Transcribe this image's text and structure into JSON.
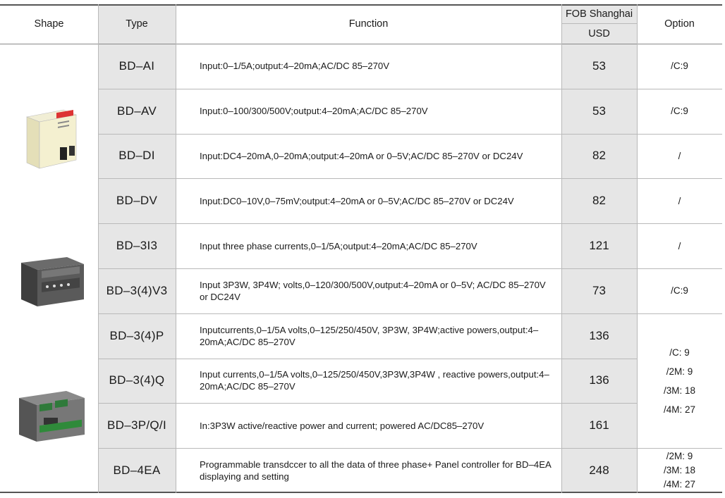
{
  "header": {
    "shape": "Shape",
    "type": "Type",
    "function": "Function",
    "fob": "FOB Shanghai",
    "currency": "USD",
    "option": "Option"
  },
  "rows": [
    {
      "type": "BD–AI",
      "function": "Input:0–1/5A;output:4–20mA;AC/DC 85–270V",
      "price": "53",
      "option": "/C:9"
    },
    {
      "type": "BD–AV",
      "function": "Input:0–100/300/500V;output:4–20mA;AC/DC 85–270V",
      "price": "53",
      "option": "/C:9"
    },
    {
      "type": "BD–DI",
      "function": "Input:DC4–20mA,0–20mA;output:4–20mA or 0–5V;AC/DC 85–270V or DC24V",
      "price": "82",
      "option": "/"
    },
    {
      "type": "BD–DV",
      "function": "Input:DC0–10V,0–75mV;output:4–20mA or 0–5V;AC/DC 85–270V or DC24V",
      "price": "82",
      "option": "/"
    },
    {
      "type": "BD–3I3",
      "function": "Input three phase currents,0–1/5A;output:4–20mA;AC/DC 85–270V",
      "price": "121",
      "option": "/"
    },
    {
      "type": "BD–3(4)V3",
      "function": "Input 3P3W, 3P4W; volts,0–120/300/500V,output:4–20mA or 0–5V; AC/DC 85–270V or DC24V",
      "price": "73",
      "option": "/C:9"
    },
    {
      "type": "BD–3(4)P",
      "function": "Inputcurrents,0–1/5A volts,0–125/250/450V,  3P3W, 3P4W;active powers,output:4–20mA;AC/DC 85–270V",
      "price": "136"
    },
    {
      "type": "BD–3(4)Q",
      "function": "Input currents,0–1/5A volts,0–125/250/450V,3P3W,3P4W , reactive powers,output:4–20mA;AC/DC 85–270V",
      "price": "136"
    },
    {
      "type": "BD–3P/Q/I",
      "function": "In:3P3W active/reactive power and current; powered AC/DC85–270V",
      "price": "161"
    },
    {
      "type": "BD–4EA",
      "function": "Programmable transdccer to all the data of three phase+ Panel controller  for BD–4EA displaying and setting",
      "price": "248"
    }
  ],
  "merged_options": {
    "power": [
      "/C: 9",
      "/2M: 9",
      "/3M: 18",
      "/4M: 27"
    ],
    "ea": [
      "/2M: 9",
      "/3M: 18",
      "/4M: 27"
    ]
  },
  "images": {
    "single_module": "din-rail-transducer-icon",
    "three_phase_module": "three-phase-transducer-icon",
    "power_module": "power-transducer-icon"
  },
  "colors": {
    "shade": "#e6e6e6",
    "line": "#b9b9b9"
  }
}
